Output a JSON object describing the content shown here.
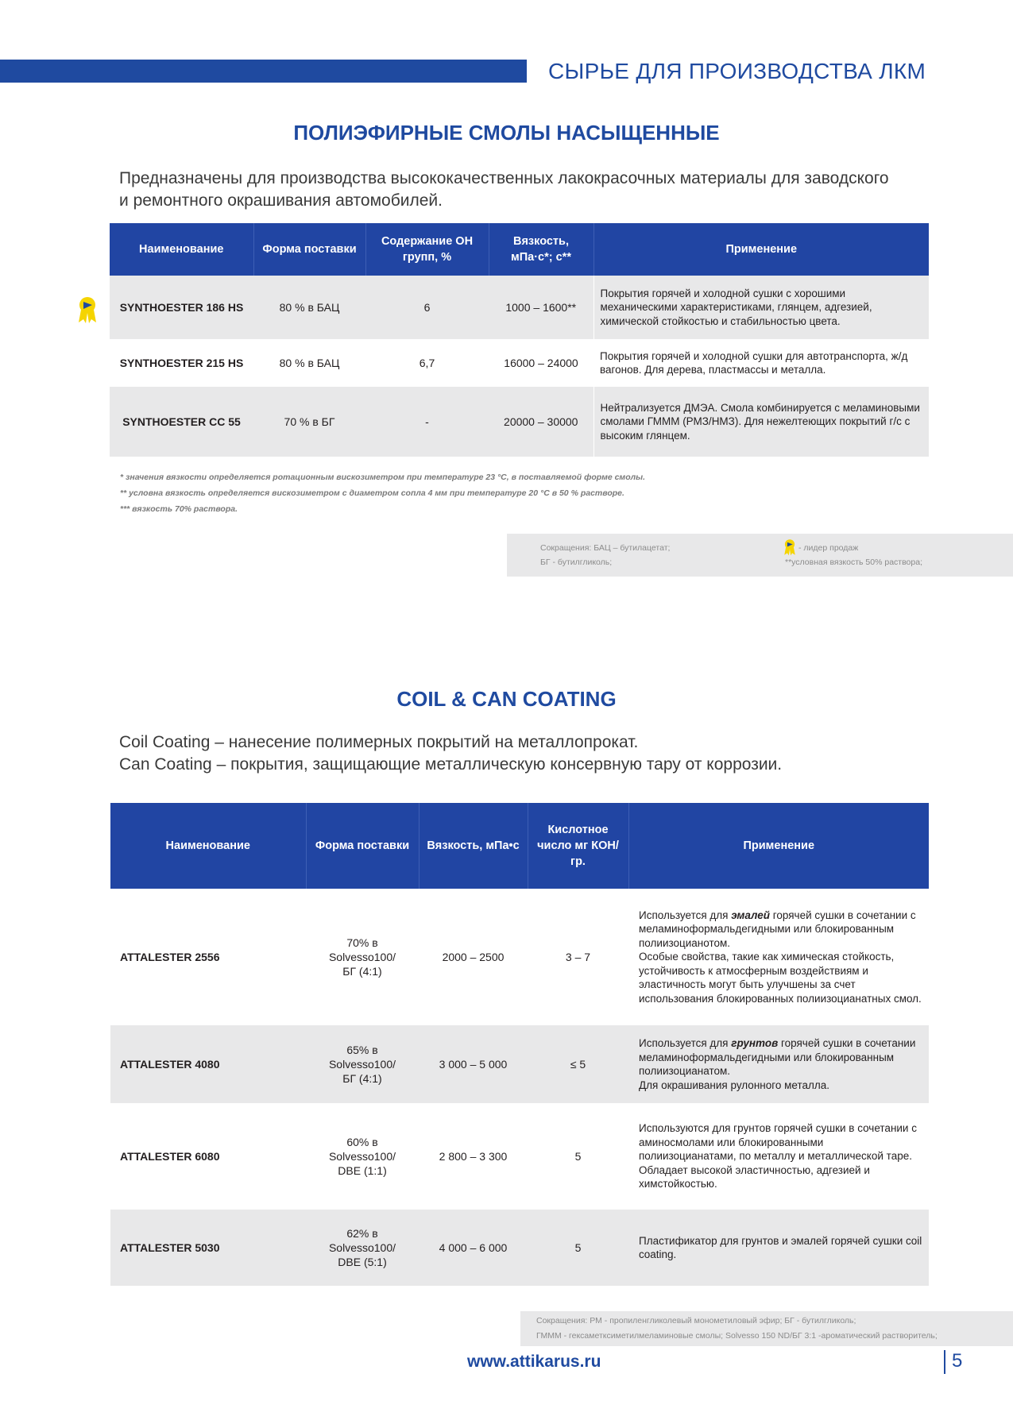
{
  "header": {
    "title": "СЫРЬЕ ДЛЯ ПРОИЗВОДСТВА ЛКМ"
  },
  "section1": {
    "title": "ПОЛИЭФИРНЫЕ СМОЛЫ НАСЫЩЕННЫЕ",
    "intro_line1": "Предназначены для производства высококачественных лакокрасочных материалы для заводского",
    "intro_line2": "и ремонтного окрашивания автомобилей.",
    "columns": [
      "Наименование",
      "Форма поставки",
      "Содержание ОН групп, %",
      "Вязкость, мПа·с*; с**",
      "Применение"
    ],
    "rows": [
      {
        "name": "SYNTHOESTER 186 HS",
        "form": "80 % в БАЦ",
        "oh": "6",
        "visc": "1000 – 1600**",
        "app": "Покрытия горячей и холодной сушки с хорошими механическими характеристиками, глянцем, адгезией, химической стойкостью и стабильностью цвета.",
        "badge": "sales-leader-icon"
      },
      {
        "name": "SYNTHOESTER 215 HS",
        "form": "80 % в БАЦ",
        "oh": "6,7",
        "visc": "16000 – 24000",
        "app": "Покрытия горячей и холодной сушки для автотранспорта, ж/д вагонов. Для дерева, пластмассы и металла."
      },
      {
        "name": "SYNTHOESTER CC 55",
        "form": "70 % в БГ",
        "oh": "-",
        "visc": "20000 – 30000",
        "app": "Нейтрализуется ДМЭА. Смола комбинируется с меламиновыми смолами ГММM (РМЗ/НМЗ). Для нежелтеющих покрытий г/с с высоким глянцем."
      }
    ],
    "notes": [
      "* значения вязкости определяется ротационным вискозиметром при температуре 23 °С, в поставляемой форме смолы.",
      "** условна вязкость определяется вискозиметром с диаметром сопла 4 мм при температуре 20 °С в 50 % растворе.",
      "*** вязкость 70% раствора."
    ],
    "abbr": {
      "line1": "Сокращения:  БАЦ – бутилацетат;",
      "line2": "БГ - бутилгликоль;",
      "leader": "- лидер продаж",
      "visc_note": "**условная вязкость 50% раствора;"
    }
  },
  "section2": {
    "title": "COIL & CAN COATING",
    "intro_line1": "Coil Coating – нанесение полимерных покрытий на металлопрокат.",
    "intro_line2": "Can Coating – покрытия, защищающие металлическую консервную тару от коррозии.",
    "columns": [
      "Наименование",
      "Форма поставки",
      "Вязкость, мПа•с",
      "Кислотное число мг КОН/гр.",
      "Применение"
    ],
    "rows": [
      {
        "name": "ATTALESTER 2556",
        "form": [
          "70% в",
          "Solvesso100/",
          "БГ (4:1)"
        ],
        "visc": "2000 – 2500",
        "acid": "3 – 7",
        "app_pre": "Используется для ",
        "app_em": "эмалей",
        "app_post": " горячей сушки в сочетании с меламиноформальдегидными или блокированным полиизоцианотом.",
        "app_extra": "Особые свойства, такие как химическая стойкость, устойчивость к атмосферным воздействиям и эластичность могут быть улучшены за счет использования блокированных полиизоцианатных смол."
      },
      {
        "name": "ATTALESTER 4080",
        "form": [
          "65%  в",
          "Solvesso100/",
          "БГ (4:1)"
        ],
        "visc": "3 000 – 5 000",
        "acid": "≤ 5",
        "app_pre": "Используется для ",
        "app_em": "грунтов",
        "app_post": " горячей сушки в сочетании меламиноформальдегидными или блокированным полиизоцианатом.",
        "app_extra": "Для окрашивания рулонного металла."
      },
      {
        "name": "ATTALESTER 6080",
        "form": [
          "60%  в",
          "Solvesso100/",
          "DBE (1:1)"
        ],
        "visc": "2 800 – 3 300",
        "acid": "5",
        "app_pre": "Используются для грунтов горячей сушки в сочетании с аминосмолами или блокированными полиизоцианатами, по металлу и металлической таре. Обладает высокой эластичностью, адгезией и химстойкостью.",
        "app_em": "",
        "app_post": "",
        "app_extra": ""
      },
      {
        "name": "ATTALESTER 5030",
        "form": [
          "62%  в",
          "Solvesso100/",
          "DBE (5:1)"
        ],
        "visc": "4 000 – 6 000",
        "acid": "5",
        "app_pre": "Пластификатор для грунтов и эмалей горячей сушки coil coating.",
        "app_em": "",
        "app_post": "",
        "app_extra": ""
      }
    ],
    "abbr": {
      "line1": "Сокращения: РМ - пропиленгликолевый монометиловый эфир;         БГ - бутилгликоль;",
      "line2": "ГМММ - гексаметксиметилмеламиновые смолы; Solvesso 150 ND/БГ 3:1 -ароматический растворитель;"
    }
  },
  "footer": {
    "site": "www.attikarus.ru",
    "page": "5"
  },
  "colors": {
    "brand_blue": "#1f4aa0",
    "header_cell": "#2145a3",
    "row_gray": "#e8e8e9",
    "badge_yellow": "#f5d400"
  }
}
